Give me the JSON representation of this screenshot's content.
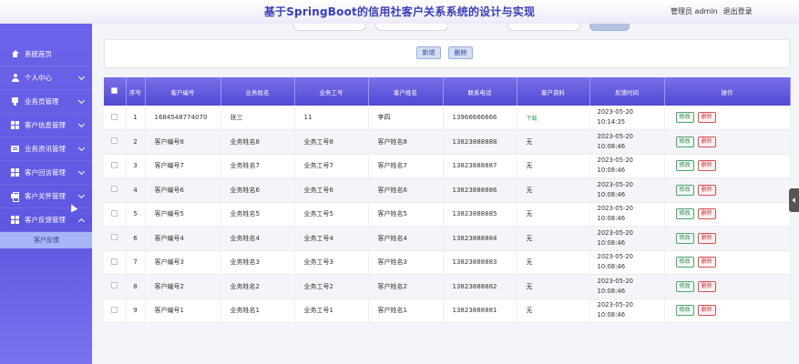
{
  "header": {
    "title": "基于SpringBoot的信用社客户关系系统的设计与实现",
    "user_label": "管理员 admin",
    "logout_label": "退出登录"
  },
  "sidebar": {
    "items": [
      {
        "label": "系统首页",
        "icon": "home-icon"
      },
      {
        "label": "个人中心",
        "icon": "user-icon"
      },
      {
        "label": "业务员管理",
        "icon": "badge-icon"
      },
      {
        "label": "客户信息管理",
        "icon": "grid-icon"
      },
      {
        "label": "业务资讯管理",
        "icon": "news-icon"
      },
      {
        "label": "客户回访管理",
        "icon": "grid-icon"
      },
      {
        "label": "客户关怀管理",
        "icon": "printer-icon"
      },
      {
        "label": "客户反馈管理",
        "icon": "grid-icon"
      }
    ],
    "submenu_label": "客户反馈"
  },
  "toolbar": {
    "add_label": "新增",
    "delete_label": "删除"
  },
  "table": {
    "headers": [
      "",
      "序号",
      "客户编号",
      "业务姓名",
      "业务工号",
      "客户姓名",
      "联系电话",
      "客户资料",
      "反馈时间",
      "操作"
    ],
    "rows": [
      {
        "no": "1",
        "cust_no": "1684548774070",
        "biz_name": "张三",
        "biz_id": "11",
        "cust_name": "李四",
        "phone": "13966666666",
        "doc": "下载",
        "time": "2023-05-20 10:14:35"
      },
      {
        "no": "2",
        "cust_no": "客户编号8",
        "biz_name": "业务姓名8",
        "biz_id": "业务工号8",
        "cust_name": "客户姓名8",
        "phone": "13823888888",
        "doc": "无",
        "time": "2023-05-20 10:08:46"
      },
      {
        "no": "3",
        "cust_no": "客户编号7",
        "biz_name": "业务姓名7",
        "biz_id": "业务工号7",
        "cust_name": "客户姓名7",
        "phone": "13823888887",
        "doc": "无",
        "time": "2023-05-20 10:08:46"
      },
      {
        "no": "4",
        "cust_no": "客户编号6",
        "biz_name": "业务姓名6",
        "biz_id": "业务工号6",
        "cust_name": "客户姓名6",
        "phone": "13823888886",
        "doc": "无",
        "time": "2023-05-20 10:08:46"
      },
      {
        "no": "5",
        "cust_no": "客户编号5",
        "biz_name": "业务姓名5",
        "biz_id": "业务工号5",
        "cust_name": "客户姓名5",
        "phone": "13823888885",
        "doc": "无",
        "time": "2023-05-20 10:08:46"
      },
      {
        "no": "6",
        "cust_no": "客户编号4",
        "biz_name": "业务姓名4",
        "biz_id": "业务工号4",
        "cust_name": "客户姓名4",
        "phone": "13823888884",
        "doc": "无",
        "time": "2023-05-20 10:08:46"
      },
      {
        "no": "7",
        "cust_no": "客户编号3",
        "biz_name": "业务姓名3",
        "biz_id": "业务工号3",
        "cust_name": "客户姓名3",
        "phone": "13823888883",
        "doc": "无",
        "time": "2023-05-20 10:08:46"
      },
      {
        "no": "8",
        "cust_no": "客户编号2",
        "biz_name": "业务姓名2",
        "biz_id": "业务工号2",
        "cust_name": "客户姓名2",
        "phone": "13823888882",
        "doc": "无",
        "time": "2023-05-20 10:08:46"
      },
      {
        "no": "9",
        "cust_no": "客户编号1",
        "biz_name": "业务姓名1",
        "biz_id": "业务工号1",
        "cust_name": "客户姓名1",
        "phone": "13823888881",
        "doc": "无",
        "time": "2023-05-20 10:08:46"
      }
    ],
    "edit_label": "修改",
    "delete_label": "删除"
  },
  "colors": {
    "sidebar": "#6a62e8",
    "header_title": "#3a3fb8",
    "table_header": "#5a50dc",
    "download_link": "#2f9f5a",
    "edit_button": "#2f7f4d",
    "delete_button": "#c23a3a"
  }
}
